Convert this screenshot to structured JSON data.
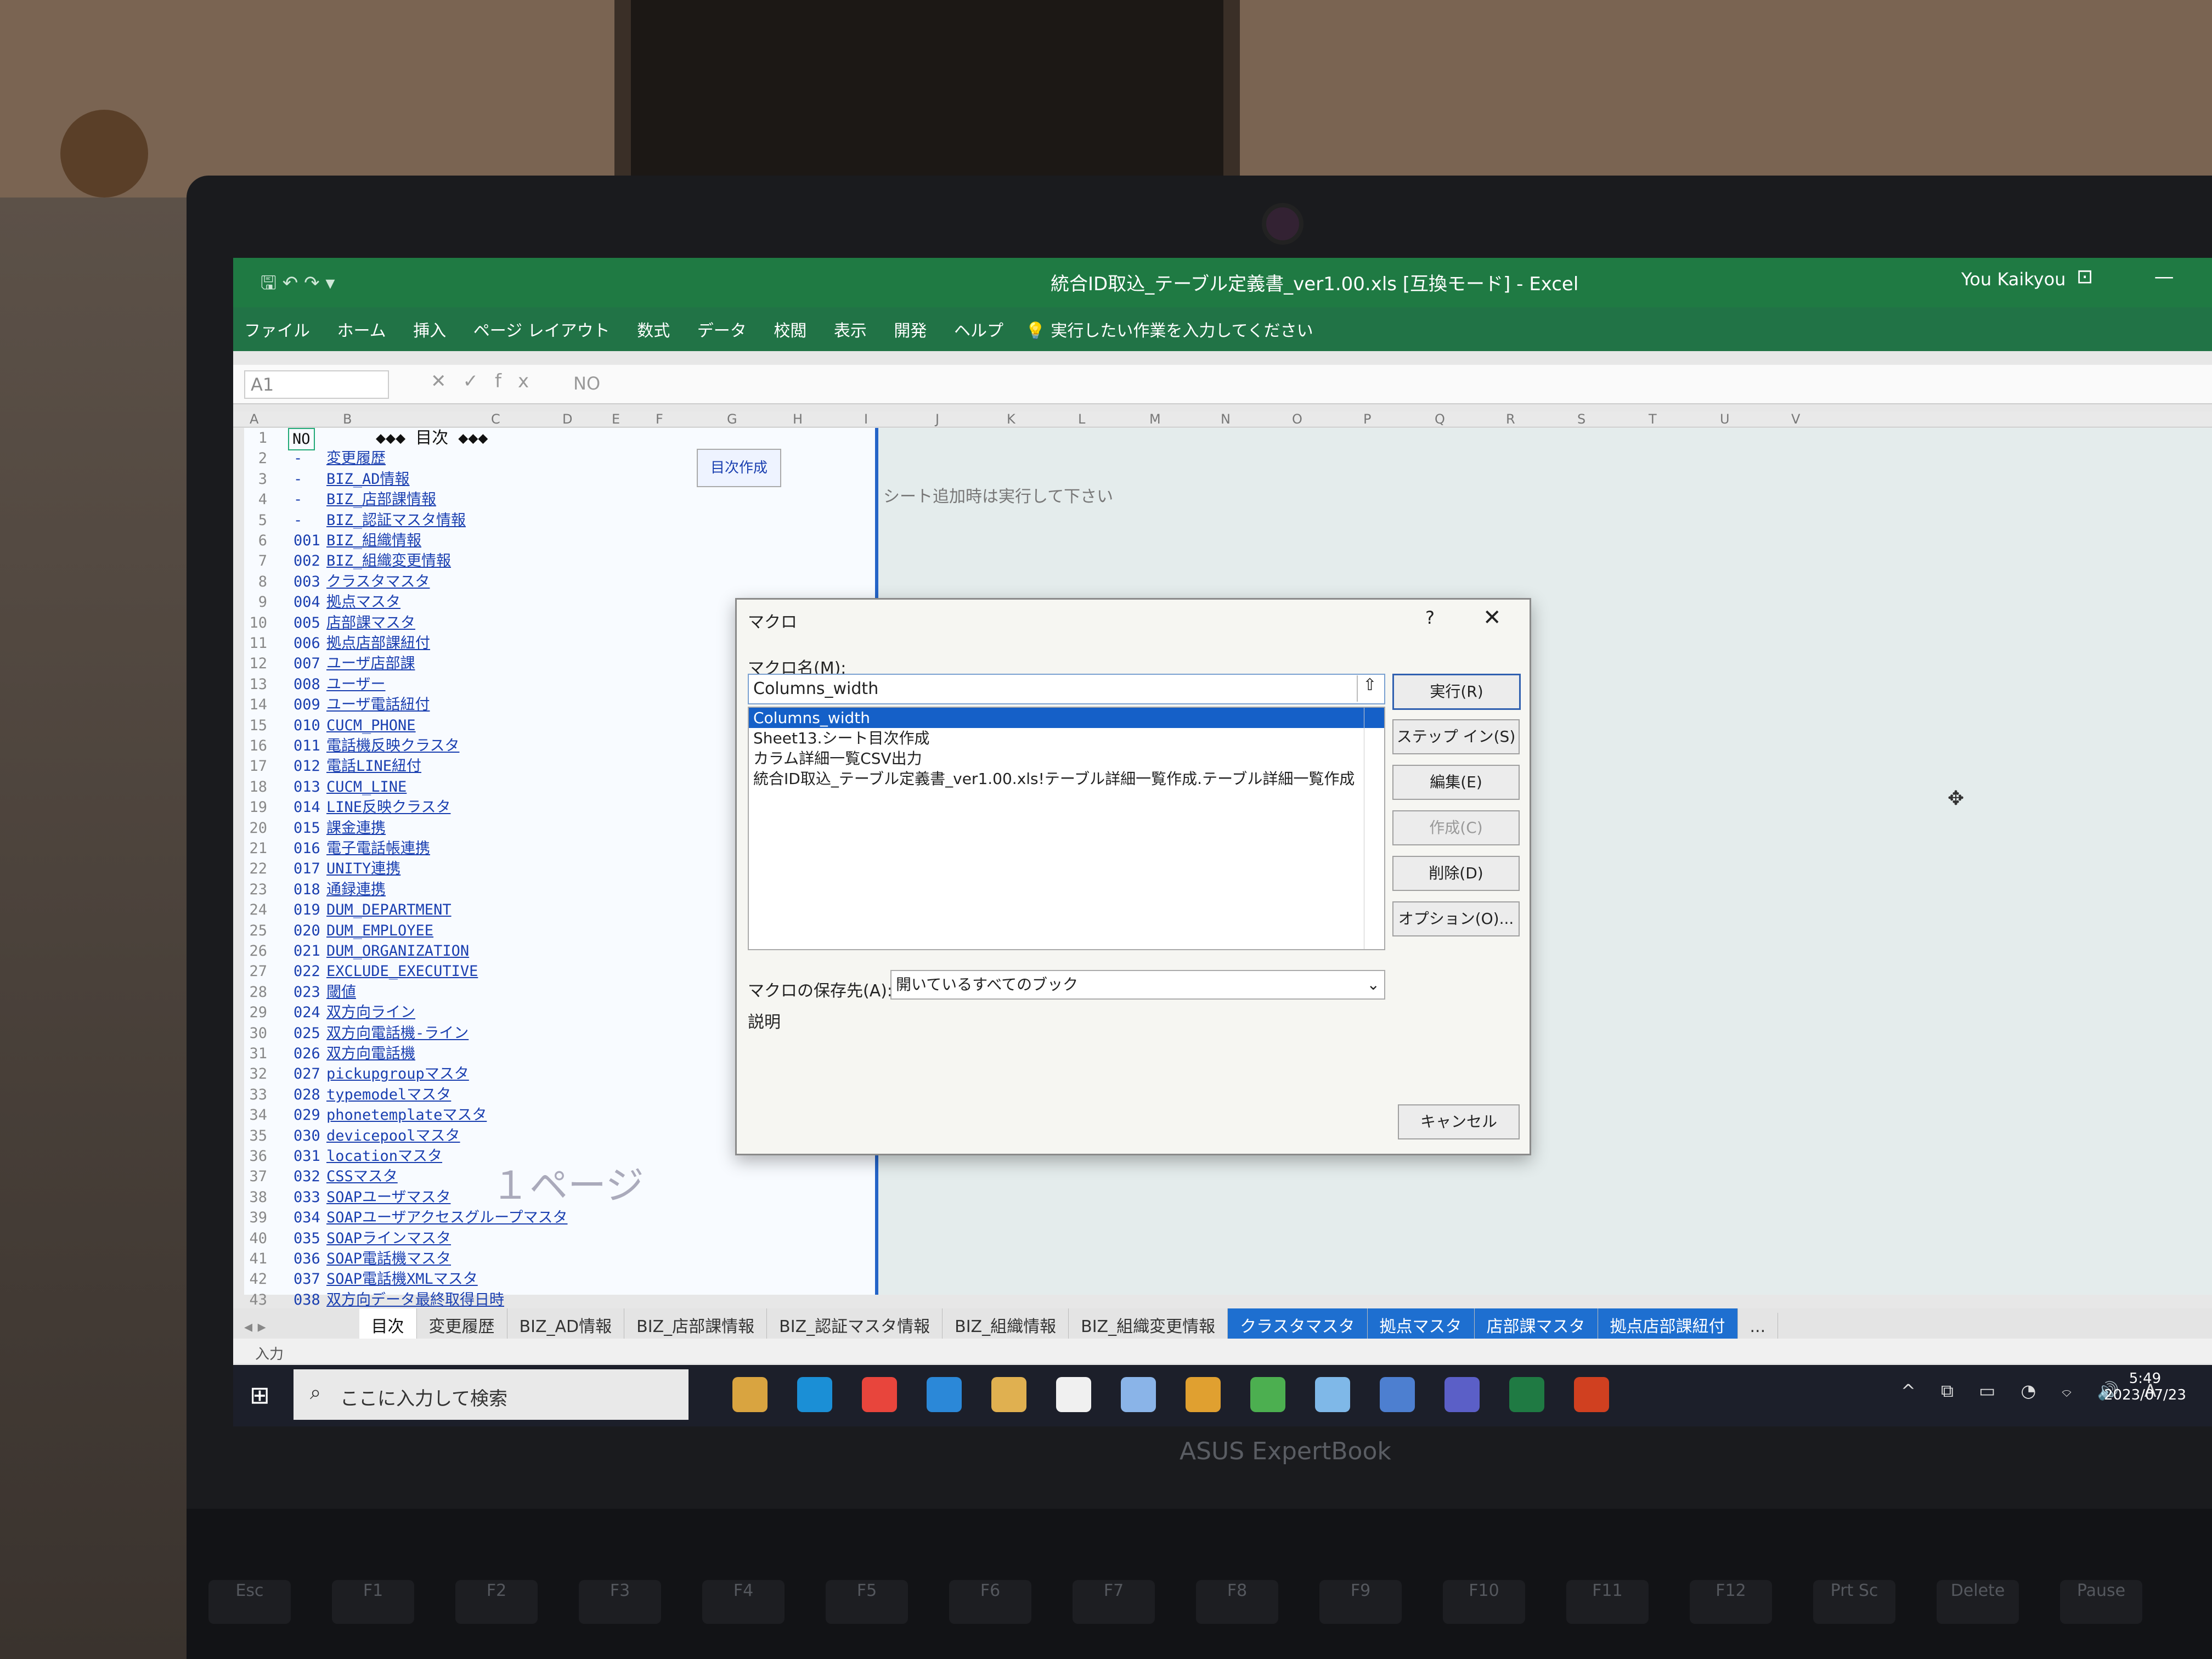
{
  "window": {
    "title": "統合ID取込_テーブル定義書_ver1.00.xls [互換モード] - Excel",
    "user": "You Kaikyou",
    "qat": "🖫 ↶ ↷ ▾",
    "controls": "⊡ —"
  },
  "ribbon": {
    "tabs": [
      "ファイル",
      "ホーム",
      "挿入",
      "ページ レイアウト",
      "数式",
      "データ",
      "校閲",
      "表示",
      "開発",
      "ヘルプ"
    ],
    "tellme": "実行したい作業を入力してください"
  },
  "formula_bar": {
    "cell": "A1",
    "value": "NO"
  },
  "columns": [
    "A",
    "B",
    "C",
    "D",
    "E",
    "F",
    "G",
    "H",
    "I",
    "J",
    "K",
    "L",
    "M",
    "N",
    "O",
    "P",
    "Q",
    "R",
    "S",
    "T",
    "U",
    "V"
  ],
  "sheet": {
    "header_no": "NO",
    "header_title": "◆◆◆ 目次 ◆◆◆",
    "toc_button": "目次作成",
    "note": "シート追加時は実行して下さい",
    "page_watermark": "１ページ",
    "rows": [
      {
        "rn": "2",
        "no": "-",
        "name": "変更履歴"
      },
      {
        "rn": "3",
        "no": "-",
        "name": "BIZ_AD情報"
      },
      {
        "rn": "4",
        "no": "-",
        "name": "BIZ_店部課情報"
      },
      {
        "rn": "5",
        "no": "-",
        "name": "BIZ_認証マスタ情報"
      },
      {
        "rn": "6",
        "no": "001",
        "name": "BIZ_組織情報"
      },
      {
        "rn": "7",
        "no": "002",
        "name": "BIZ_組織変更情報"
      },
      {
        "rn": "8",
        "no": "003",
        "name": "クラスタマスタ"
      },
      {
        "rn": "9",
        "no": "004",
        "name": "拠点マスタ"
      },
      {
        "rn": "10",
        "no": "005",
        "name": "店部課マスタ"
      },
      {
        "rn": "11",
        "no": "006",
        "name": "拠点店部課紐付"
      },
      {
        "rn": "12",
        "no": "007",
        "name": "ユーザ店部課"
      },
      {
        "rn": "13",
        "no": "008",
        "name": "ユーザー"
      },
      {
        "rn": "14",
        "no": "009",
        "name": "ユーザ電話紐付"
      },
      {
        "rn": "15",
        "no": "010",
        "name": "CUCM_PHONE"
      },
      {
        "rn": "16",
        "no": "011",
        "name": "電話機反映クラスタ"
      },
      {
        "rn": "17",
        "no": "012",
        "name": "電話LINE紐付"
      },
      {
        "rn": "18",
        "no": "013",
        "name": "CUCM_LINE"
      },
      {
        "rn": "19",
        "no": "014",
        "name": "LINE反映クラスタ"
      },
      {
        "rn": "20",
        "no": "015",
        "name": "課金連携"
      },
      {
        "rn": "21",
        "no": "016",
        "name": "電子電話帳連携"
      },
      {
        "rn": "22",
        "no": "017",
        "name": "UNITY連携"
      },
      {
        "rn": "23",
        "no": "018",
        "name": "通録連携"
      },
      {
        "rn": "24",
        "no": "019",
        "name": "DUM_DEPARTMENT"
      },
      {
        "rn": "25",
        "no": "020",
        "name": "DUM_EMPLOYEE"
      },
      {
        "rn": "26",
        "no": "021",
        "name": "DUM_ORGANIZATION"
      },
      {
        "rn": "27",
        "no": "022",
        "name": "EXCLUDE_EXECUTIVE"
      },
      {
        "rn": "28",
        "no": "023",
        "name": "閾値"
      },
      {
        "rn": "29",
        "no": "024",
        "name": "双方向ライン"
      },
      {
        "rn": "30",
        "no": "025",
        "name": "双方向電話機-ライン"
      },
      {
        "rn": "31",
        "no": "026",
        "name": "双方向電話機"
      },
      {
        "rn": "32",
        "no": "027",
        "name": "pickupgroupマスタ"
      },
      {
        "rn": "33",
        "no": "028",
        "name": "typemodelマスタ"
      },
      {
        "rn": "34",
        "no": "029",
        "name": "phonetemplateマスタ"
      },
      {
        "rn": "35",
        "no": "030",
        "name": "devicepoolマスタ"
      },
      {
        "rn": "36",
        "no": "031",
        "name": "locationマスタ"
      },
      {
        "rn": "37",
        "no": "032",
        "name": "CSSマスタ"
      },
      {
        "rn": "38",
        "no": "033",
        "name": "SOAPユーザマスタ"
      },
      {
        "rn": "39",
        "no": "034",
        "name": "SOAPユーザアクセスグループマスタ"
      },
      {
        "rn": "40",
        "no": "035",
        "name": "SOAPラインマスタ"
      },
      {
        "rn": "41",
        "no": "036",
        "name": "SOAP電話機マスタ"
      },
      {
        "rn": "42",
        "no": "037",
        "name": "SOAP電話機XMLマスタ"
      },
      {
        "rn": "43",
        "no": "038",
        "name": "双方向データ最終取得日時"
      }
    ]
  },
  "sheet_tabs": [
    {
      "label": "目次",
      "style": "active"
    },
    {
      "label": "変更履歴",
      "style": ""
    },
    {
      "label": "BIZ_AD情報",
      "style": ""
    },
    {
      "label": "BIZ_店部課情報",
      "style": ""
    },
    {
      "label": "BIZ_認証マスタ情報",
      "style": ""
    },
    {
      "label": "BIZ_組織情報",
      "style": ""
    },
    {
      "label": "BIZ_組織変更情報",
      "style": ""
    },
    {
      "label": "クラスタマスタ",
      "style": "blue"
    },
    {
      "label": "拠点マスタ",
      "style": "blue"
    },
    {
      "label": "店部課マスタ",
      "style": "blue"
    },
    {
      "label": "拠点店部課紐付",
      "style": "blue"
    },
    {
      "label": "...",
      "style": ""
    }
  ],
  "status": {
    "mode": "入力"
  },
  "taskbar": {
    "search_placeholder": "ここに入力して検索",
    "tray": "^ ⧉ ▭ ◔ ⌔ 🔊 A",
    "time": "5:49",
    "date": "2023/07/23",
    "icon_colors": [
      "#d9a440",
      "#1b8fd6",
      "#e8453c",
      "#2b88d8",
      "#e0b050",
      "#f0f0f0",
      "#8ab4e8",
      "#e0a030",
      "#4caf50",
      "#7fb8e8",
      "#4d7fd0",
      "#5b5fc7",
      "#1f7a43",
      "#d04020"
    ]
  },
  "dialog": {
    "title": "マクロ",
    "help": "?",
    "close": "✕",
    "name_label": "マクロ名(M):",
    "name_value": "Columns_width",
    "macros": [
      "Columns_width",
      "Sheet13.シート目次作成",
      "カラム詳細一覧CSV出力",
      "統合ID取込_テーブル定義書_ver1.00.xls!テーブル詳細一覧作成.テーブル詳細一覧作成"
    ],
    "store_label": "マクロの保存先(A):",
    "store_value": "開いているすべてのブック",
    "desc_label": "説明",
    "buttons": {
      "run": "実行(R)",
      "step": "ステップ イン(S)",
      "edit": "編集(E)",
      "create": "作成(C)",
      "delete": "削除(D)",
      "options": "オプション(O)...",
      "cancel": "キャンセル"
    }
  },
  "laptop": {
    "brand": "ASUS ExpertBook",
    "fkeys": [
      "Esc",
      "F1",
      "F2",
      "F3",
      "F4",
      "F5",
      "F6",
      "F7",
      "F8",
      "F9",
      "F10",
      "F11",
      "F12",
      "Prt Sc",
      "Delete",
      "Pause"
    ]
  }
}
